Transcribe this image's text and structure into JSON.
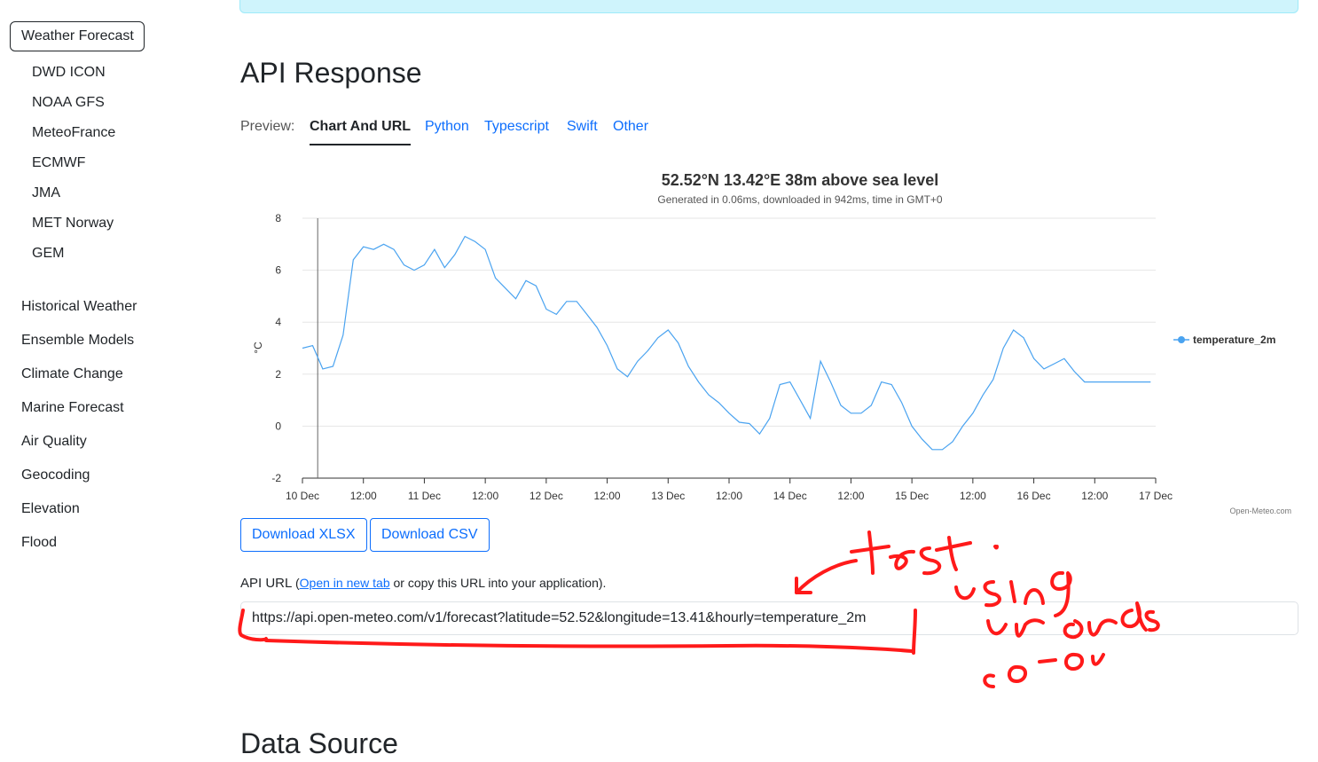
{
  "sidebar": {
    "active": "Weather Forecast",
    "sub_items": [
      "DWD ICON",
      "NOAA GFS",
      "MeteoFrance",
      "ECMWF",
      "JMA",
      "MET Norway",
      "GEM"
    ],
    "items": [
      "Historical Weather",
      "Ensemble Models",
      "Climate Change",
      "Marine Forecast",
      "Air Quality",
      "Geocoding",
      "Elevation",
      "Flood"
    ]
  },
  "main": {
    "api_response_heading": "API Response",
    "preview_label": "Preview:",
    "tabs": [
      "Chart And URL",
      "Python",
      "Typescript",
      "Swift",
      "Other"
    ],
    "active_tab": "Chart And URL",
    "download_xlsx": "Download XLSX",
    "download_csv": "Download CSV",
    "api_url_label": "API URL",
    "api_url_paren_open": "(",
    "api_url_link": "Open in new tab",
    "api_url_rest": " or copy this URL into your application).",
    "api_url_value": "https://api.open-meteo.com/v1/forecast?latitude=52.52&longitude=13.41&hourly=temperature_2m",
    "data_source_heading": "Data Source"
  },
  "colors": {
    "accent": "#0d6efd",
    "series": "#4aa3f0",
    "annotation": "#ff0000"
  },
  "chart_data": {
    "type": "line",
    "title": "52.52°N 13.42°E 38m above sea level",
    "subtitle": "Generated in 0.06ms, downloaded in 942ms, time in GMT+0",
    "ylabel": "°C",
    "credit": "Open-Meteo.com",
    "ylim": [
      -2,
      8
    ],
    "yticks": [
      -2,
      0,
      2,
      4,
      6,
      8
    ],
    "xticks": [
      "10 Dec",
      "12:00",
      "11 Dec",
      "12:00",
      "12 Dec",
      "12:00",
      "13 Dec",
      "12:00",
      "14 Dec",
      "12:00",
      "15 Dec",
      "12:00",
      "16 Dec",
      "12:00",
      "17 Dec"
    ],
    "legend": "right",
    "series": [
      {
        "name": "temperature_2m",
        "x_hours": [
          0,
          2,
          4,
          6,
          8,
          10,
          12,
          14,
          16,
          18,
          20,
          22,
          24,
          26,
          28,
          30,
          32,
          34,
          36,
          38,
          40,
          42,
          44,
          46,
          48,
          50,
          52,
          54,
          56,
          58,
          60,
          62,
          64,
          66,
          68,
          70,
          72,
          74,
          76,
          78,
          80,
          82,
          84,
          86,
          88,
          90,
          92,
          94,
          96,
          98,
          100,
          102,
          104,
          106,
          108,
          110,
          112,
          114,
          116,
          118,
          120,
          122,
          124,
          126,
          128,
          130,
          132,
          134,
          136,
          138,
          140,
          142,
          144,
          146,
          148,
          150,
          152,
          154,
          156,
          158,
          160,
          162,
          164,
          166,
          167
        ],
        "values": [
          3.0,
          3.1,
          2.2,
          2.3,
          3.5,
          6.4,
          6.9,
          6.8,
          7.0,
          6.8,
          6.2,
          6.0,
          6.2,
          6.8,
          6.1,
          6.6,
          7.3,
          7.1,
          6.8,
          5.7,
          5.3,
          4.9,
          5.6,
          5.4,
          4.5,
          4.3,
          4.8,
          4.8,
          4.3,
          3.8,
          3.1,
          2.2,
          1.9,
          2.5,
          2.9,
          3.4,
          3.7,
          3.2,
          2.3,
          1.7,
          1.2,
          0.9,
          0.5,
          0.15,
          0.1,
          -0.3,
          0.3,
          1.6,
          1.7,
          1.0,
          0.3,
          2.5,
          1.7,
          0.8,
          0.5,
          0.5,
          0.8,
          1.7,
          1.6,
          0.9,
          0.0,
          -0.5,
          -0.9,
          -0.9,
          -0.6,
          0.0,
          0.5,
          1.2,
          1.8,
          3.0,
          3.7,
          3.4,
          2.6,
          2.2,
          2.4,
          2.6,
          2.1,
          1.7,
          1.7,
          1.7,
          1.7,
          1.7,
          1.7,
          1.7,
          1.7
        ]
      }
    ]
  }
}
